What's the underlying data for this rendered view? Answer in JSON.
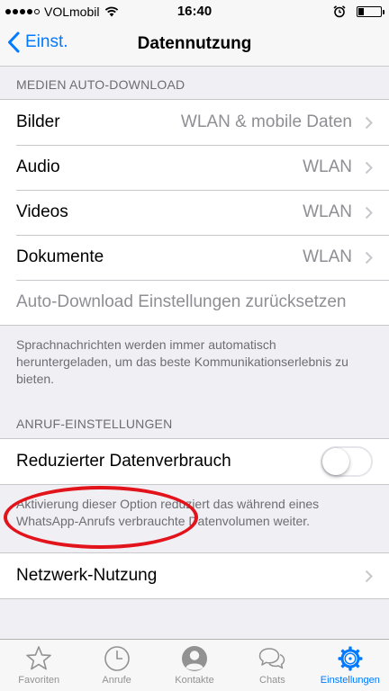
{
  "status_bar": {
    "carrier": "VOLmobil",
    "time": "16:40"
  },
  "nav": {
    "back_label": "Einst.",
    "title": "Datennutzung"
  },
  "media_section": {
    "header": "MEDIEN AUTO-DOWNLOAD",
    "items": [
      {
        "label": "Bilder",
        "value": "WLAN & mobile Daten"
      },
      {
        "label": "Audio",
        "value": "WLAN"
      },
      {
        "label": "Videos",
        "value": "WLAN"
      },
      {
        "label": "Dokumente",
        "value": "WLAN"
      }
    ],
    "reset_label": "Auto-Download Einstellungen zurücksetzen",
    "footer": "Sprachnachrichten werden immer automatisch heruntergeladen, um das beste Kommunikationserlebnis zu bieten."
  },
  "call_section": {
    "header": "ANRUF-EINSTELLUNGEN",
    "toggle_label": "Reduzierter Datenverbrauch",
    "toggle_on": false,
    "footer": "Aktivierung dieser Option reduziert das während eines WhatsApp-Anrufs verbrauchte Datenvolumen weiter."
  },
  "network": {
    "label": "Netzwerk-Nutzung"
  },
  "tabbar": {
    "tabs": [
      {
        "label": "Favoriten",
        "icon": "star-icon",
        "active": false
      },
      {
        "label": "Anrufe",
        "icon": "clock-icon",
        "active": false
      },
      {
        "label": "Kontakte",
        "icon": "person-icon",
        "active": false
      },
      {
        "label": "Chats",
        "icon": "chat-bubbles-icon",
        "active": false
      },
      {
        "label": "Einstellungen",
        "icon": "gear-icon",
        "active": true
      }
    ]
  },
  "colors": {
    "accent": "#007aff",
    "annotation": "#e3131b",
    "background": "#efeff4"
  }
}
